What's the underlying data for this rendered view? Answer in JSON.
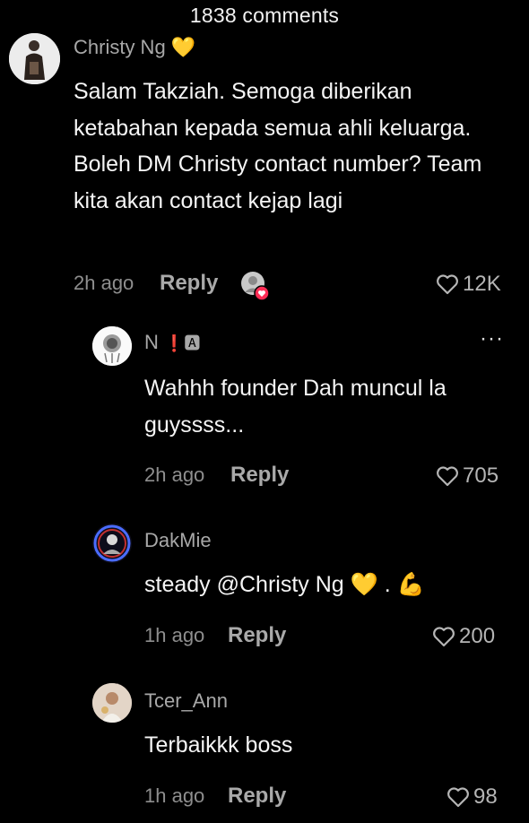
{
  "header": {
    "comment_count": "1838 comments"
  },
  "comments": [
    {
      "username": "Christy Ng",
      "username_emoji": "💛",
      "text": "Salam Takziah. Semoga diberikan ketabahan kepada semua ahli keluarga. Boleh DM Christy contact number? Team kita akan contact kejap lagi",
      "time": "2h ago",
      "reply_label": "Reply",
      "likes": "12K"
    },
    {
      "username": "N",
      "username_badges": "❗🅰",
      "text": "Wahhh founder Dah muncul la guyssss...",
      "time": "2h ago",
      "reply_label": "Reply",
      "likes": "705",
      "more_label": "···"
    },
    {
      "username": "DakMie",
      "text": "steady @Christy Ng 💛 . 💪",
      "time": "1h ago",
      "reply_label": "Reply",
      "likes": "200"
    },
    {
      "username": "Tcer_Ann",
      "text": "Terbaikkk boss",
      "time": "1h ago",
      "reply_label": "Reply",
      "likes": "98"
    }
  ],
  "colors": {
    "background": "#000000",
    "text_primary": "#f5f5f5",
    "text_secondary": "#8e8e8e",
    "creator_like_badge": "#fe2c55"
  }
}
